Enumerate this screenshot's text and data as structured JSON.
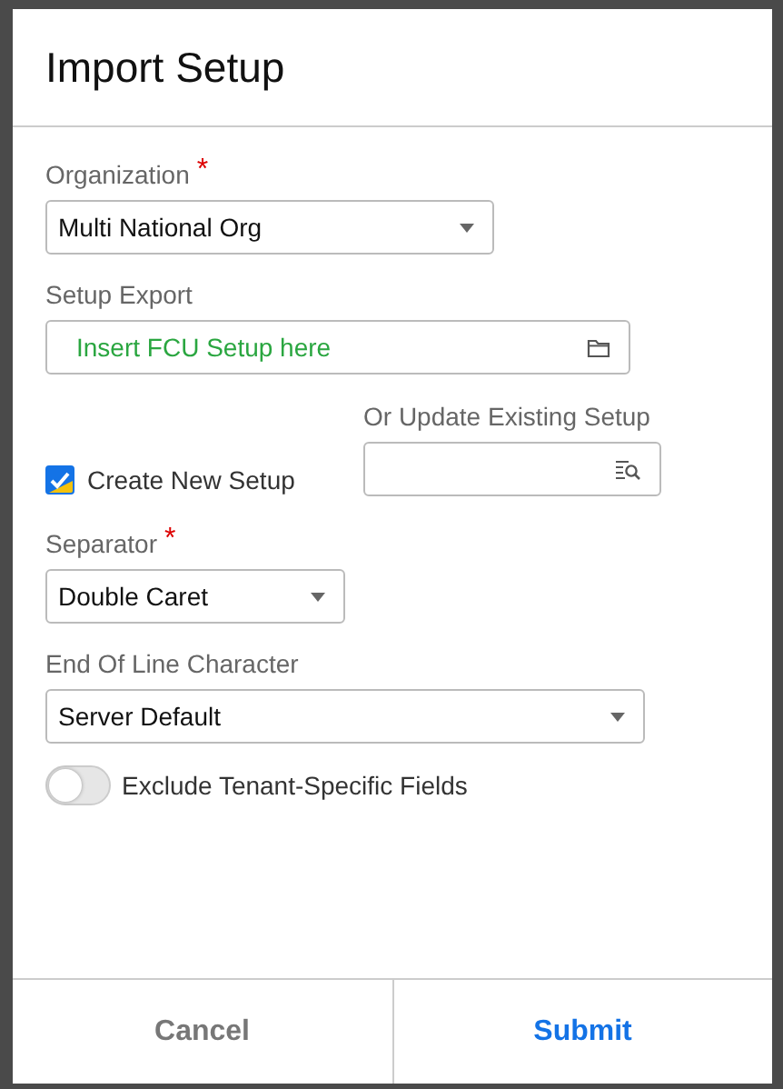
{
  "dialog": {
    "title": "Import Setup"
  },
  "organization": {
    "label": "Organization",
    "required_mark": "*",
    "value": "Multi National Org"
  },
  "setup_export": {
    "label": "Setup Export",
    "placeholder": "Insert FCU Setup here"
  },
  "create_new": {
    "label": "Create New Setup",
    "checked": true
  },
  "update_existing": {
    "label": "Or Update Existing Setup"
  },
  "separator": {
    "label": "Separator",
    "required_mark": "*",
    "value": "Double Caret"
  },
  "end_of_line": {
    "label": "End Of Line Character",
    "value": "Server Default"
  },
  "exclude_tenant": {
    "label": "Exclude Tenant-Specific Fields",
    "on": false
  },
  "buttons": [
    {
      "label": "Cancel",
      "kind": "secondary"
    },
    {
      "label": "Submit",
      "kind": "primary"
    }
  ]
}
